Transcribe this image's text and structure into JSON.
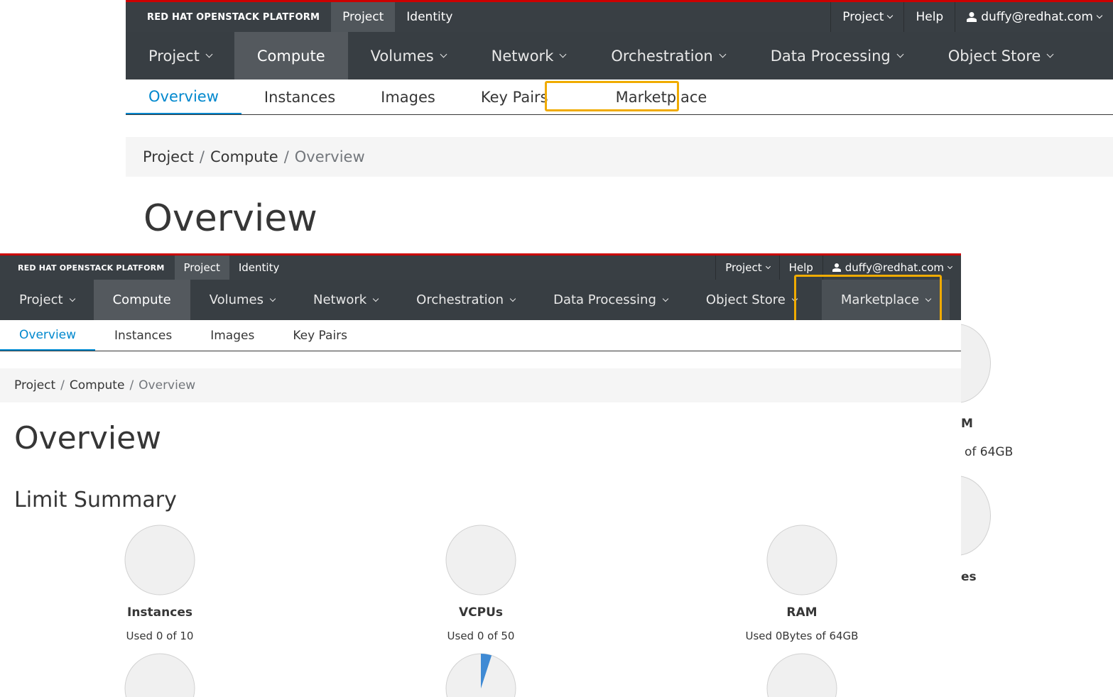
{
  "background_view": {
    "brand": "RED HAT OPENSTACK PLATFORM",
    "top_tabs": [
      "Project",
      "Identity"
    ],
    "top_right": {
      "project": "Project",
      "help": "Help",
      "user": "duffy@redhat.com"
    },
    "main_nav": [
      "Project",
      "Compute",
      "Volumes",
      "Network",
      "Orchestration",
      "Data Processing",
      "Object Store"
    ],
    "sub_nav": [
      "Overview",
      "Instances",
      "Images",
      "Key Pairs",
      "Marketplace"
    ],
    "breadcrumb": [
      "Project",
      "Compute",
      "Overview"
    ],
    "breadcrumb_sep": "/",
    "title": "Overview",
    "peek_ram_label": "M",
    "peek_ram_used": "of 64GB",
    "peek_label2": "es"
  },
  "front_view": {
    "brand": "RED HAT OPENSTACK PLATFORM",
    "top_tabs": [
      "Project",
      "Identity"
    ],
    "top_right": {
      "project": "Project",
      "help": "Help",
      "user": "duffy@redhat.com"
    },
    "main_nav": [
      "Project",
      "Compute",
      "Volumes",
      "Network",
      "Orchestration",
      "Data Processing",
      "Object Store",
      "Marketplace"
    ],
    "sub_nav": [
      "Overview",
      "Instances",
      "Images",
      "Key Pairs"
    ],
    "breadcrumb": [
      "Project",
      "Compute",
      "Overview"
    ],
    "breadcrumb_sep": "/",
    "title": "Overview",
    "limit_summary": "Limit Summary",
    "gauges": [
      {
        "name": "Instances",
        "used_text": "Used 0 of 10",
        "fraction": 0
      },
      {
        "name": "VCPUs",
        "used_text": "Used 0 of 50",
        "fraction": 0
      },
      {
        "name": "RAM",
        "used_text": "Used 0Bytes of 64GB",
        "fraction": 0
      }
    ],
    "gauges_row2": [
      {
        "fraction": 0
      },
      {
        "fraction": 0.05
      },
      {
        "fraction": 0
      }
    ]
  },
  "colors": {
    "accent": "#0088ce",
    "highlight": "#f0ab00",
    "brand_red": "#cc0000",
    "gauge_fill": "#3f8ad4"
  }
}
